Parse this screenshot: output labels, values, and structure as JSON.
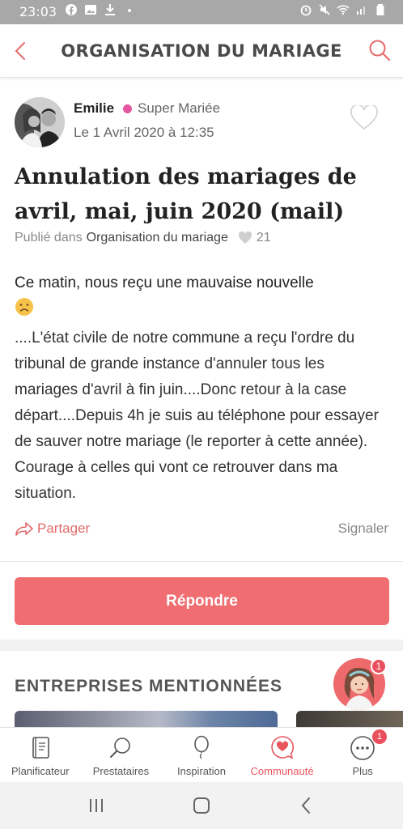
{
  "status_bar": {
    "time": "23:03",
    "left_icons": [
      "facebook-icon",
      "image-icon",
      "download-icon",
      "dot-icon"
    ],
    "right_icons": [
      "alarm-icon",
      "mute-icon",
      "wifi-icon",
      "signal-icon",
      "battery-icon"
    ]
  },
  "header": {
    "title": "ORGANISATION DU MARIAGE",
    "back_icon": "chevron-left-icon",
    "search_icon": "search-icon"
  },
  "post": {
    "author": "Emilie",
    "badge": "Super Mariée",
    "date": "Le 1 Avril 2020 à 12:35",
    "title": "Annulation des mariages de avril, mai, juin 2020 (mail)",
    "published_in_label": "Publié dans",
    "category": "Organisation du mariage",
    "likes": "21",
    "body_first_line": "Ce matin, nous reçu une mauvaise nouvelle",
    "body_emoji": "frowning-face-icon",
    "body": "....L'état civile de notre commune a reçu l'ordre du tribunal de grande instance d'annuler tous les mariages d'avril à fin juin....Donc retour à la case départ....Depuis 4h je suis au téléphone pour essayer de sauver notre mariage (le reporter à cette année). Courage à celles qui vont ce retrouver dans ma situation.",
    "share_label": "Partager",
    "report_label": "Signaler"
  },
  "reply_button": "Répondre",
  "mentioned": {
    "title": "ENTREPRISES MENTIONNÉES"
  },
  "assistant": {
    "badge_count": "1"
  },
  "bottom_nav": {
    "items": [
      {
        "label": "Planificateur",
        "icon": "planner-book-icon"
      },
      {
        "label": "Prestataires",
        "icon": "search-icon"
      },
      {
        "label": "Inspiration",
        "icon": "balloon-icon"
      },
      {
        "label": "Communauté",
        "icon": "chat-heart-icon",
        "active": true
      },
      {
        "label": "Plus",
        "icon": "more-dots-icon",
        "badge": "1"
      }
    ]
  },
  "colors": {
    "accent": "#f06e72",
    "active_nav": "#e9565e",
    "badge_pink": "#e557a0"
  }
}
